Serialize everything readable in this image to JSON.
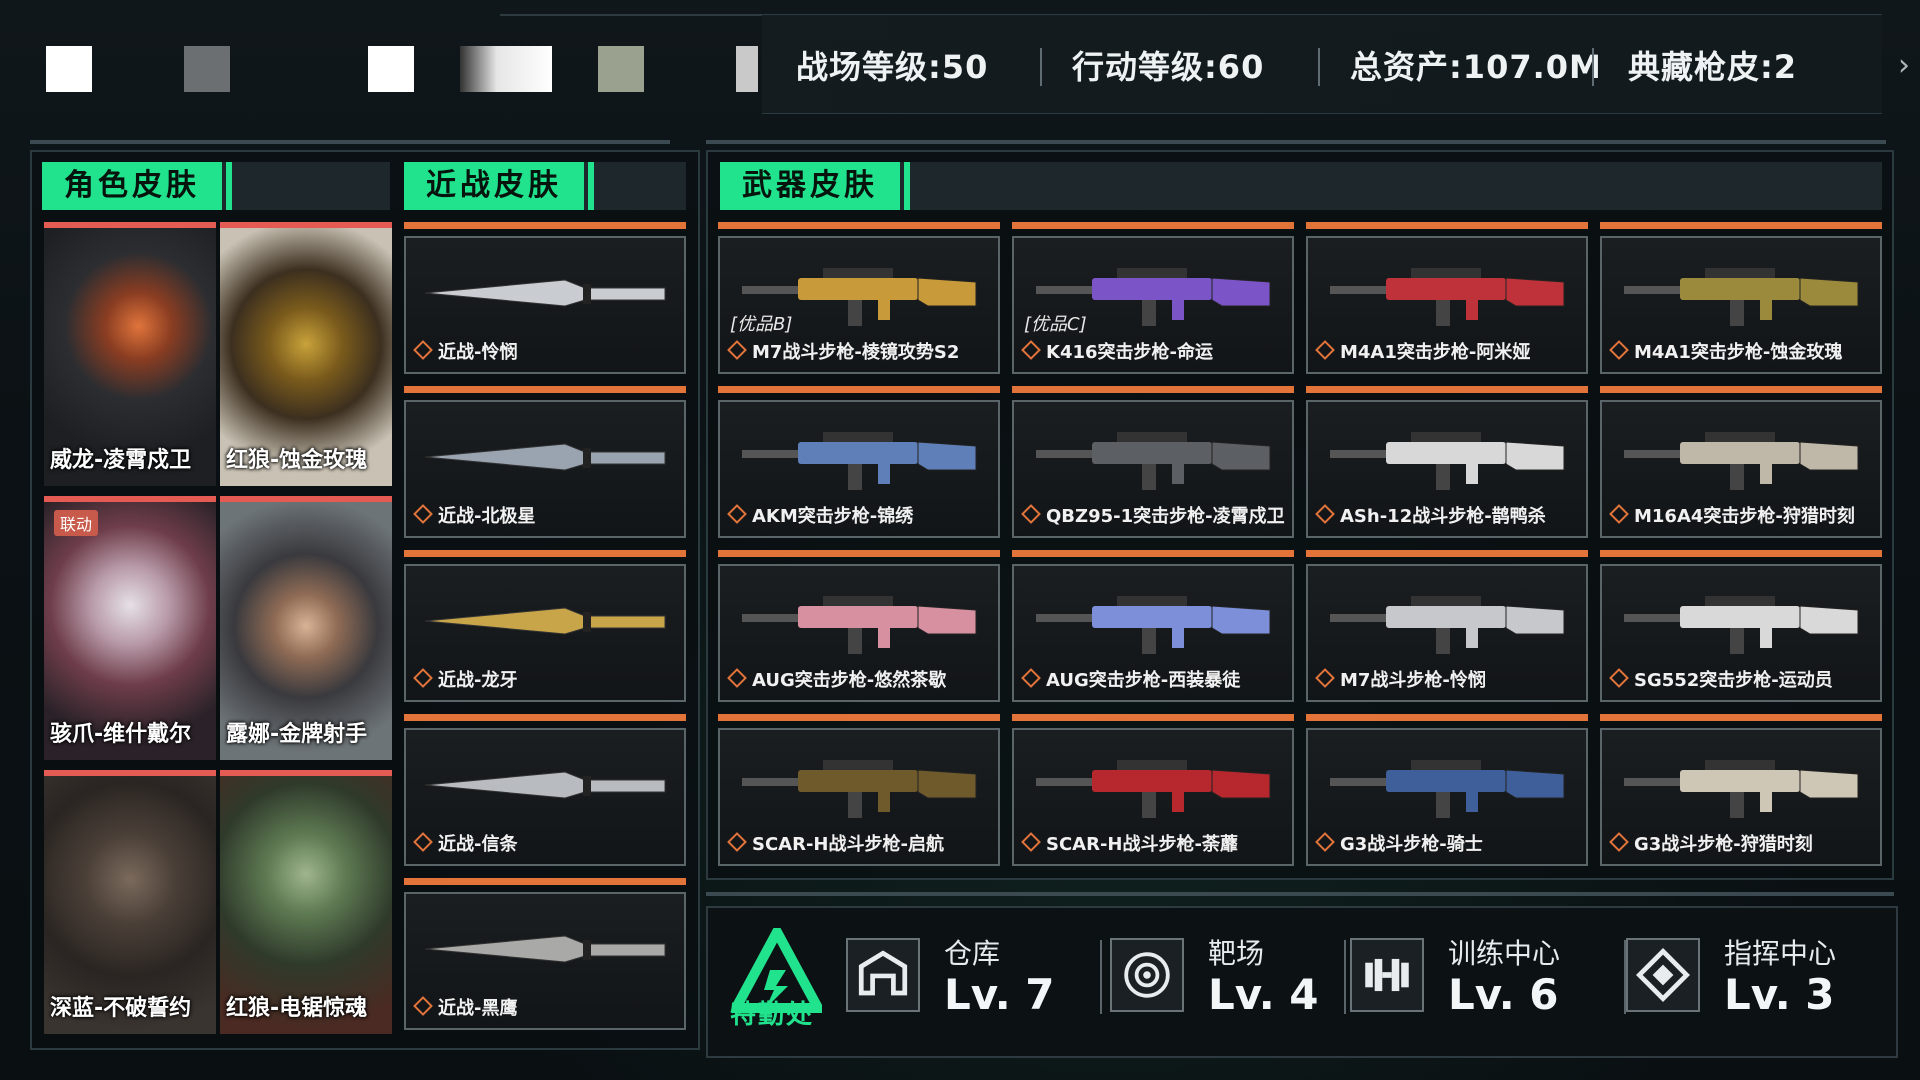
{
  "header": {
    "stats": [
      {
        "label": "战场等级:50"
      },
      {
        "label": "行动等级:60"
      },
      {
        "label": "总资产:107.0M"
      },
      {
        "label": "典藏枪皮:2"
      }
    ],
    "next_icon": "chevron-right-icon"
  },
  "sections": {
    "character": {
      "title": "角色皮肤"
    },
    "melee": {
      "title": "近战皮肤"
    },
    "weapon": {
      "title": "武器皮肤"
    }
  },
  "characters": [
    {
      "name": "威龙-凌霄戍卫",
      "tag": ""
    },
    {
      "name": "红狼-蚀金玫瑰",
      "tag": ""
    },
    {
      "name": "骇爪-维什戴尔",
      "tag": "联动"
    },
    {
      "name": "露娜-金牌射手",
      "tag": ""
    },
    {
      "name": "深蓝-不破誓约",
      "tag": ""
    },
    {
      "name": "红狼-电锯惊魂",
      "tag": ""
    }
  ],
  "melee": [
    {
      "name": "近战-怜悯"
    },
    {
      "name": "近战-北极星"
    },
    {
      "name": "近战-龙牙"
    },
    {
      "name": "近战-信条"
    },
    {
      "name": "近战-黑鹰"
    }
  ],
  "weapons": [
    {
      "grade": "[优品B]",
      "name": "M7战斗步枪-棱镜攻势S2"
    },
    {
      "grade": "[优品C]",
      "name": "K416突击步枪-命运"
    },
    {
      "grade": "",
      "name": "M4A1突击步枪-阿米娅"
    },
    {
      "grade": "",
      "name": "M4A1突击步枪-蚀金玫瑰"
    },
    {
      "grade": "",
      "name": "AKM突击步枪-锦绣"
    },
    {
      "grade": "",
      "name": "QBZ95-1突击步枪-凌霄戍卫"
    },
    {
      "grade": "",
      "name": "ASh-12战斗步枪-鹊鸭杀"
    },
    {
      "grade": "",
      "name": "M16A4突击步枪-狩猎时刻"
    },
    {
      "grade": "",
      "name": "AUG突击步枪-悠然茶歇"
    },
    {
      "grade": "",
      "name": "AUG突击步枪-西装暴徒"
    },
    {
      "grade": "",
      "name": "M7战斗步枪-怜悯"
    },
    {
      "grade": "",
      "name": "SG552突击步枪-运动员"
    },
    {
      "grade": "",
      "name": "SCAR-H战斗步枪-启航"
    },
    {
      "grade": "",
      "name": "SCAR-H战斗步枪-荼蘼"
    },
    {
      "grade": "",
      "name": "G3战斗步枪-骑士"
    },
    {
      "grade": "",
      "name": "G3战斗步枪-狩猎时刻"
    }
  ],
  "facility": {
    "logo_label": "特勤处",
    "items": [
      {
        "name": "仓库",
        "level": "Lv. 7",
        "icon": "warehouse-icon"
      },
      {
        "name": "靶场",
        "level": "Lv. 4",
        "icon": "target-icon"
      },
      {
        "name": "训练中心",
        "level": "Lv. 6",
        "icon": "dumbbell-icon"
      },
      {
        "name": "指挥中心",
        "level": "Lv. 3",
        "icon": "command-icon"
      }
    ]
  },
  "colors": {
    "accent": "#22e38d",
    "card_top": "#e2743a",
    "char_top": "#e35b52"
  }
}
